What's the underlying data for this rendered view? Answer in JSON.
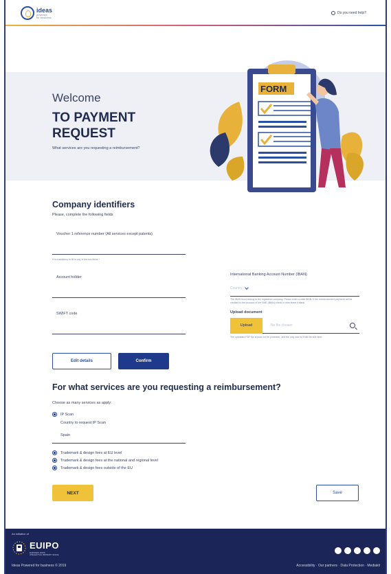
{
  "header": {
    "logo_title": "ideas",
    "logo_sub": "powered",
    "logo_tag": "for business",
    "help_label": "Do you need help?"
  },
  "hero": {
    "welcome": "Welcome",
    "headline": "TO PAYMENT REQUEST",
    "subtitle": "What services are you requesting a reimbursement?",
    "form_label": "FORM"
  },
  "company": {
    "title": "Company identifiers",
    "subtitle": "Please, complete the following fields",
    "voucher_label": "Voucher 1 reference number (All services except patents)",
    "voucher_helper": "It is mandatory to fill in any of the two fields *",
    "account_holder_label": "Account holder",
    "iban_label": "International Banking Account Number (IBAN)",
    "country_placeholder": "Country",
    "iban_helper": "The IBAN must belong to the registered company. Please enter a valid IBAN. If the reimbursement payment will be credited to the account of the SME (IBAN) check or else leave it blank.",
    "swift_label": "SWIFT code",
    "upload_label": "Upload document",
    "upload_button": "Upload",
    "no_file": "No file chosen",
    "upload_helper": "The uploaded PDF file should not be protected, and the only size is 5 MB file size limit.",
    "edit_button": "Edit details",
    "confirm_button": "Confirm"
  },
  "services": {
    "title": "For what services are you requesting a reimbursement?",
    "subtitle": "Choose as many services as apply:",
    "ip_scan_label": "IP Scan",
    "country_request_label": "Country to request IP Scan",
    "country_value": "Spain",
    "options": [
      "Trademark & design fees at EU level",
      "Trademark & design fees at the national and regional level",
      "Trademark & design fees outside of the EU"
    ],
    "next_button": "NEXT",
    "save_button": "Save"
  },
  "footer": {
    "initiative": "An initiative of",
    "euipo": "EUIPO",
    "euipo_sub1": "EUROPEAN UNION",
    "euipo_sub2": "INTELLECTUAL PROPERTY OFFICE",
    "copyright": "Ideas Powered for business © 2019",
    "links": "Accessibility · Our partners · Data Protection · Mediakit",
    "socials": [
      "linkedin-icon",
      "facebook-icon",
      "twitter-icon",
      "instagram-icon",
      "youtube-icon"
    ]
  },
  "colors": {
    "navy": "#1f2a4e",
    "blue": "#1f3a8a",
    "yellow": "#f0c23a",
    "footer": "#1b2557",
    "hero_bg": "#eef0f5"
  }
}
